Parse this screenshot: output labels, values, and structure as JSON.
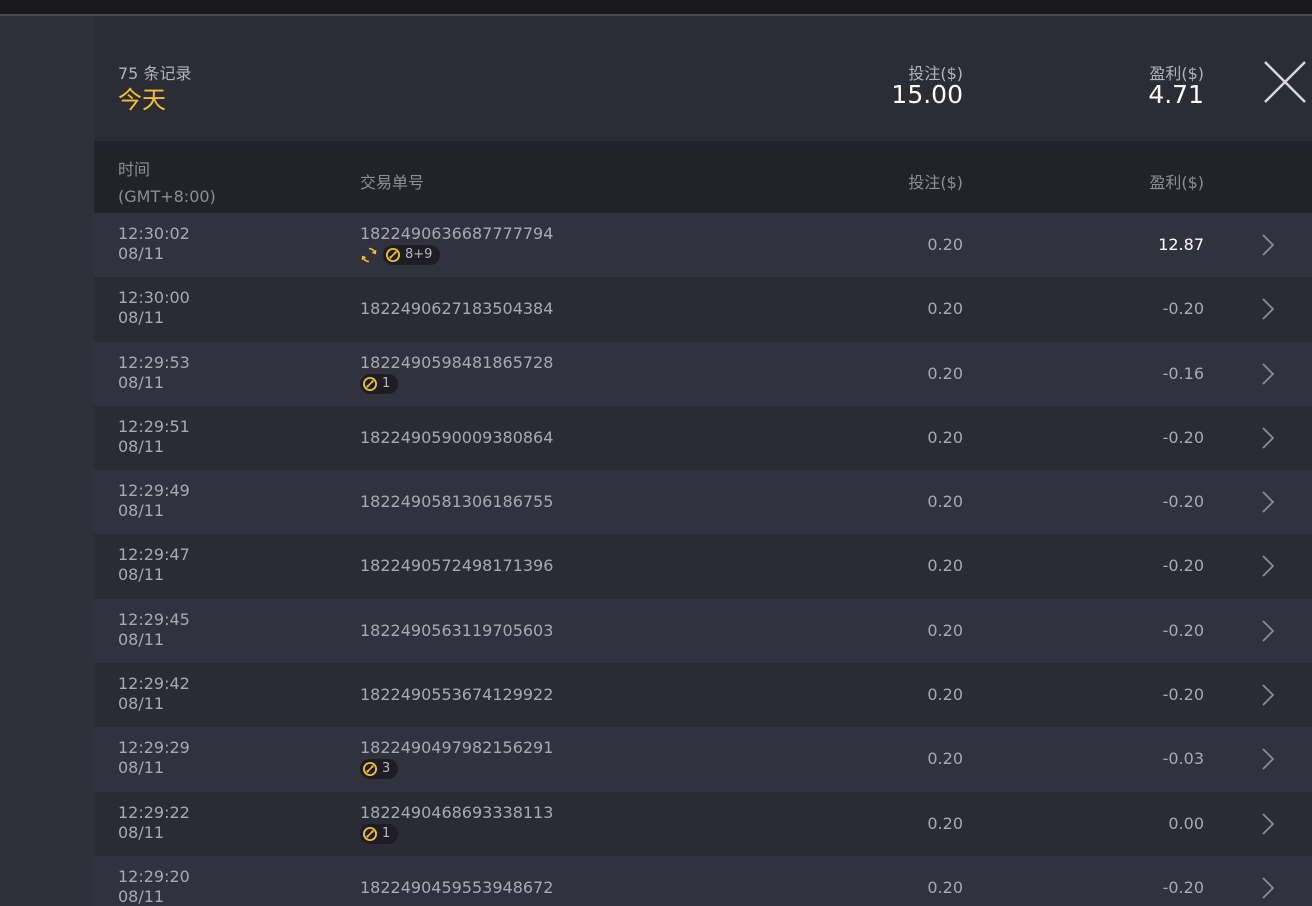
{
  "summary": {
    "record_count": "75 条记录",
    "period": "今天",
    "stake_label": "投注($)",
    "stake_value": "15.00",
    "profit_label": "盈利($)",
    "profit_value": "4.71"
  },
  "table_header": {
    "time": "时间",
    "timezone": "(GMT+8:00)",
    "order": "交易单号",
    "stake": "投注($)",
    "profit": "盈利($)"
  },
  "colors": {
    "accent": "#f2c12e",
    "panel": "#2c2c36",
    "row_alt": "#32323e",
    "header": "#222229"
  },
  "icons": {
    "close": "close-icon",
    "row_arrow": "chevron-right-icon",
    "spin": "refresh-icon",
    "coin": "coin-icon"
  },
  "rows": [
    {
      "time": "12:30:02",
      "date": "08/11",
      "order": "1822490636687777794",
      "stake": "0.20",
      "profit": "12.87",
      "positive": true,
      "spin": true,
      "badge": "8+9"
    },
    {
      "time": "12:30:00",
      "date": "08/11",
      "order": "1822490627183504384",
      "stake": "0.20",
      "profit": "-0.20",
      "positive": false,
      "spin": false,
      "badge": null
    },
    {
      "time": "12:29:53",
      "date": "08/11",
      "order": "1822490598481865728",
      "stake": "0.20",
      "profit": "-0.16",
      "positive": false,
      "spin": false,
      "badge": "1"
    },
    {
      "time": "12:29:51",
      "date": "08/11",
      "order": "1822490590009380864",
      "stake": "0.20",
      "profit": "-0.20",
      "positive": false,
      "spin": false,
      "badge": null
    },
    {
      "time": "12:29:49",
      "date": "08/11",
      "order": "1822490581306186755",
      "stake": "0.20",
      "profit": "-0.20",
      "positive": false,
      "spin": false,
      "badge": null
    },
    {
      "time": "12:29:47",
      "date": "08/11",
      "order": "1822490572498171396",
      "stake": "0.20",
      "profit": "-0.20",
      "positive": false,
      "spin": false,
      "badge": null
    },
    {
      "time": "12:29:45",
      "date": "08/11",
      "order": "1822490563119705603",
      "stake": "0.20",
      "profit": "-0.20",
      "positive": false,
      "spin": false,
      "badge": null
    },
    {
      "time": "12:29:42",
      "date": "08/11",
      "order": "1822490553674129922",
      "stake": "0.20",
      "profit": "-0.20",
      "positive": false,
      "spin": false,
      "badge": null
    },
    {
      "time": "12:29:29",
      "date": "08/11",
      "order": "1822490497982156291",
      "stake": "0.20",
      "profit": "-0.03",
      "positive": false,
      "spin": false,
      "badge": "3"
    },
    {
      "time": "12:29:22",
      "date": "08/11",
      "order": "1822490468693338113",
      "stake": "0.20",
      "profit": "0.00",
      "positive": false,
      "spin": false,
      "badge": "1"
    },
    {
      "time": "12:29:20",
      "date": "08/11",
      "order": "1822490459553948672",
      "stake": "0.20",
      "profit": "-0.20",
      "positive": false,
      "spin": false,
      "badge": null
    }
  ]
}
